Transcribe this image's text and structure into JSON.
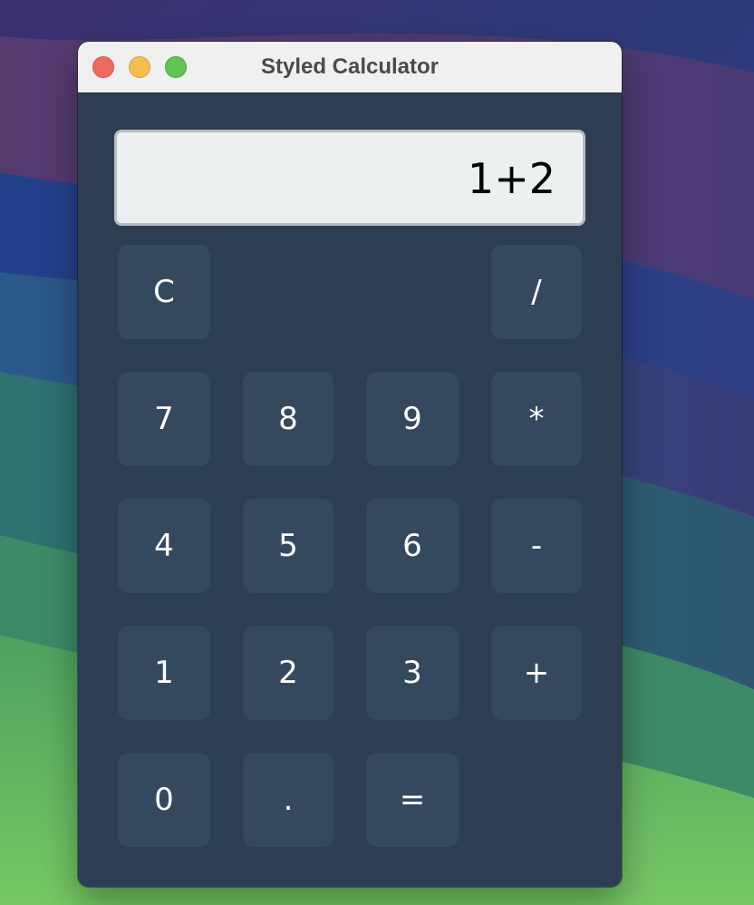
{
  "window": {
    "title": "Styled Calculator"
  },
  "display": {
    "value": "1+2"
  },
  "keys": {
    "clear": "C",
    "divide": "/",
    "seven": "7",
    "eight": "8",
    "nine": "9",
    "multiply": "*",
    "four": "4",
    "five": "5",
    "six": "6",
    "subtract": "-",
    "one": "1",
    "two": "2",
    "three": "3",
    "add": "+",
    "zero": "0",
    "decimal": ".",
    "equals": "="
  },
  "colors": {
    "window_background": "#2e3e52",
    "key_background": "#34495e",
    "key_text": "#ffffff",
    "display_background": "#ecf0f1",
    "display_border": "#b8bdc3",
    "titlebar_background": "#eff0ef",
    "traffic_close": "#ee6a5f",
    "traffic_minimize": "#f5bf4f",
    "traffic_zoom": "#61c454"
  },
  "icons": {
    "close": "close-traffic-light",
    "minimize": "minimize-traffic-light",
    "zoom": "zoom-traffic-light"
  }
}
